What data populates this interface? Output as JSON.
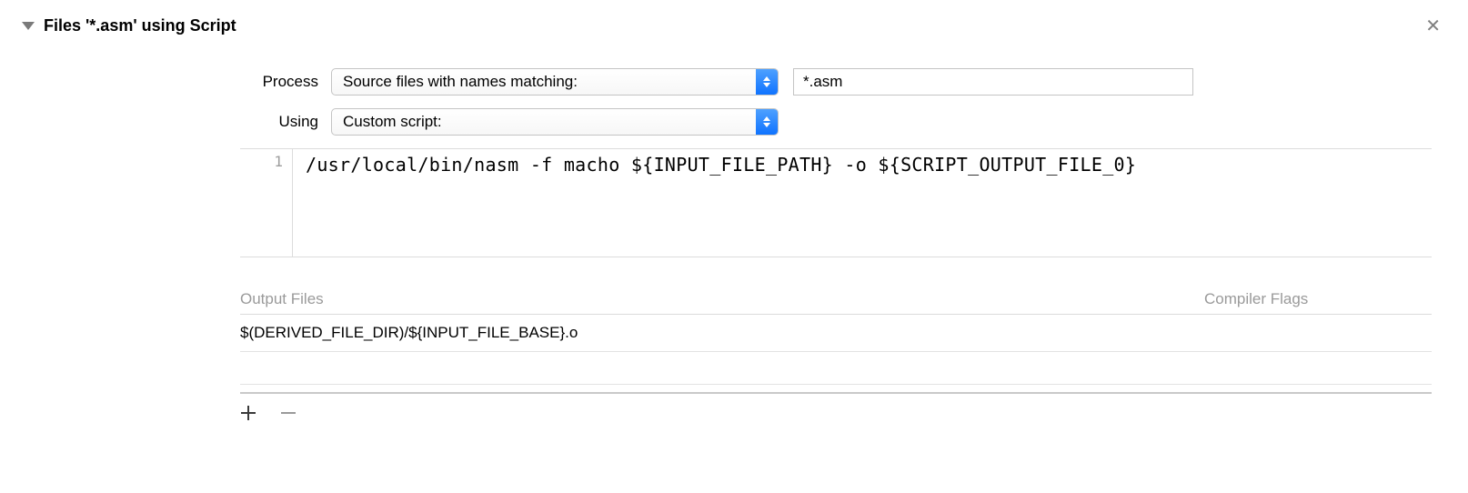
{
  "header": {
    "title": "Files '*.asm' using Script"
  },
  "form": {
    "process_label": "Process",
    "process_select": "Source files with names matching:",
    "pattern_value": "*.asm",
    "using_label": "Using",
    "using_select": "Custom script:"
  },
  "code": {
    "gutter_1": "1",
    "line_1": "/usr/local/bin/nasm -f macho ${INPUT_FILE_PATH} -o ${SCRIPT_OUTPUT_FILE_0}"
  },
  "table": {
    "header_left": "Output Files",
    "header_right": "Compiler Flags",
    "rows": [
      {
        "path": "$(DERIVED_FILE_DIR)/${INPUT_FILE_BASE}.o"
      }
    ]
  }
}
